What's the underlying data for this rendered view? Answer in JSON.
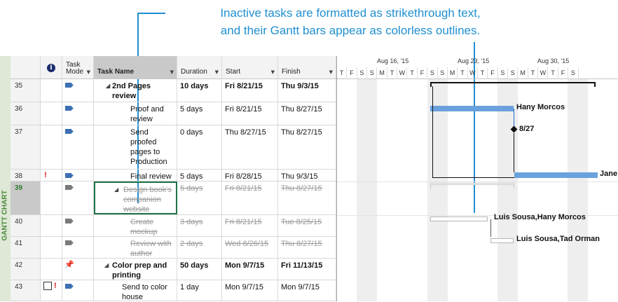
{
  "callout": {
    "line1": "Inactive tasks are formatted as strikethrough text,",
    "line2": "and their Gantt bars appear as colorless outlines."
  },
  "side_label": "GANTT CHART",
  "columns": {
    "info": "i",
    "mode_line1": "Task",
    "mode_line2": "Mode",
    "name": "Task Name",
    "duration": "Duration",
    "start": "Start",
    "finish": "Finish"
  },
  "timescale": {
    "weeks": [
      "Aug 16, '15",
      "Aug 23, '15",
      "Aug 30, '15"
    ],
    "days": [
      "T",
      "F",
      "S",
      "S",
      "M",
      "T",
      "W",
      "T",
      "F",
      "S",
      "S",
      "M",
      "T",
      "W",
      "T",
      "F",
      "S",
      "S",
      "M",
      "T",
      "W",
      "T",
      "F",
      "S"
    ]
  },
  "rows": [
    {
      "id": "35",
      "name": "2nd Pages review",
      "duration": "10 days",
      "start": "Fri 8/21/15",
      "finish": "Thu 9/3/15",
      "summary": true,
      "inactive": false,
      "indicators": "",
      "mode": "auto"
    },
    {
      "id": "36",
      "name": "Proof and review",
      "duration": "5 days",
      "start": "Fri 8/21/15",
      "finish": "Thu 8/27/15",
      "summary": false,
      "inactive": false,
      "indicators": "",
      "mode": "auto"
    },
    {
      "id": "37",
      "name": "Send proofed pages to Production",
      "duration": "0 days",
      "start": "Thu 8/27/15",
      "finish": "Thu 8/27/15",
      "summary": false,
      "inactive": false,
      "indicators": "",
      "mode": "auto"
    },
    {
      "id": "38",
      "name": "Final review",
      "duration": "5 days",
      "start": "Fri 8/28/15",
      "finish": "Thu 9/3/15",
      "summary": false,
      "inactive": false,
      "indicators": "!",
      "mode": "auto"
    },
    {
      "id": "39",
      "name": "Design book's companion website",
      "duration": "5 days",
      "start": "Fri 8/21/15",
      "finish": "Thu 8/27/15",
      "summary": true,
      "inactive": true,
      "indicators": "",
      "mode": "auto"
    },
    {
      "id": "40",
      "name": "Create mockup",
      "duration": "3 days",
      "start": "Fri 8/21/15",
      "finish": "Tue 8/25/15",
      "summary": false,
      "inactive": true,
      "indicators": "",
      "mode": "auto"
    },
    {
      "id": "41",
      "name": "Review with author",
      "duration": "2 days",
      "start": "Wed 8/26/15",
      "finish": "Thu 8/27/15",
      "summary": false,
      "inactive": true,
      "indicators": "",
      "mode": "auto"
    },
    {
      "id": "42",
      "name": "Color prep and printing",
      "duration": "50 days",
      "start": "Mon 9/7/15",
      "finish": "Fri 11/13/15",
      "summary": true,
      "inactive": false,
      "indicators": "",
      "mode": "manual"
    },
    {
      "id": "43",
      "name": "Send to color house",
      "duration": "1 day",
      "start": "Mon 9/7/15",
      "finish": "Mon 9/7/15",
      "summary": false,
      "inactive": false,
      "indicators": "link !",
      "mode": "auto"
    }
  ],
  "gantt_labels": {
    "r36": "Hany Morcos",
    "r37": "8/27",
    "r38": "Jane D",
    "r40": "Luis Sousa,Hany Morcos",
    "r41": "Luis Sousa,Tad Orman"
  },
  "colors": {
    "accent": "#1f8fd0",
    "bar": "#6aa1dd",
    "header": "#f3f3f3",
    "side": "#dfe7d6"
  }
}
